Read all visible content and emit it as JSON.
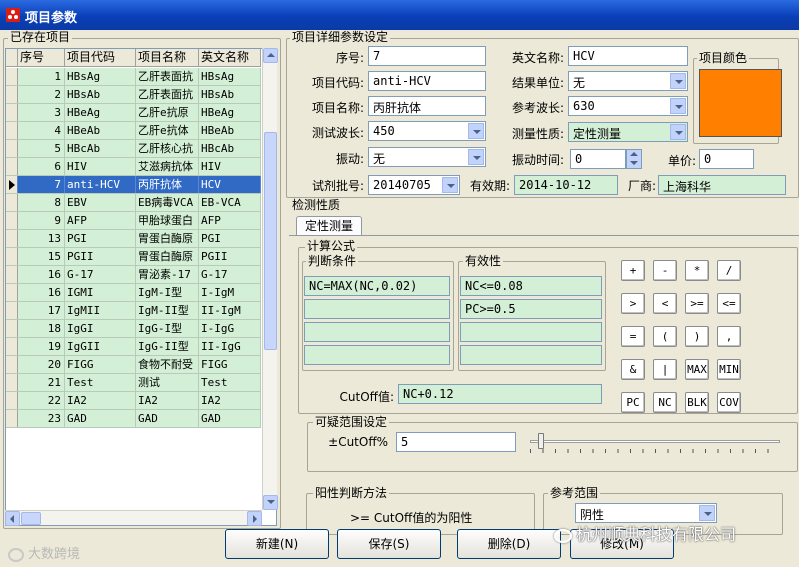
{
  "window": {
    "title": "项目参数"
  },
  "left": {
    "group_label": "已存在项目",
    "columns": [
      "序号",
      "项目代码",
      "项目名称",
      "英文名称"
    ],
    "rows": [
      [
        "1",
        "HBsAg",
        "乙肝表面抗",
        "HBsAg"
      ],
      [
        "2",
        "HBsAb",
        "乙肝表面抗",
        "HBsAb"
      ],
      [
        "3",
        "HBeAg",
        "乙肝e抗原",
        "HBeAg"
      ],
      [
        "4",
        "HBeAb",
        "乙肝e抗体",
        "HBeAb"
      ],
      [
        "5",
        "HBcAb",
        "乙肝核心抗",
        "HBcAb"
      ],
      [
        "6",
        "HIV",
        "艾滋病抗体",
        "HIV"
      ],
      [
        "7",
        "anti-HCV",
        "丙肝抗体",
        "HCV"
      ],
      [
        "8",
        "EBV",
        "EB病毒VCA",
        "EB-VCA"
      ],
      [
        "9",
        "AFP",
        "甲胎球蛋白",
        "AFP"
      ],
      [
        "13",
        "PGI",
        "胃蛋白酶原",
        "PGI"
      ],
      [
        "15",
        "PGII",
        "胃蛋白酶原",
        "PGII"
      ],
      [
        "16",
        "G-17",
        "胃泌素-17",
        "G-17"
      ],
      [
        "16",
        "IGMI",
        "IgM-I型",
        "I-IgM"
      ],
      [
        "17",
        "IgMII",
        "IgM-II型",
        "II-IgM"
      ],
      [
        "18",
        "IgGI",
        "IgG-I型",
        "I-IgG"
      ],
      [
        "19",
        "IgGII",
        "IgG-II型",
        "II-IgG"
      ],
      [
        "20",
        "FIGG",
        "食物不耐受",
        "FIGG"
      ],
      [
        "21",
        "Test",
        "测试",
        "Test"
      ],
      [
        "22",
        "IA2",
        "IA2",
        "IA2"
      ],
      [
        "23",
        "GAD",
        "GAD",
        "GAD"
      ]
    ],
    "selected_index": 6
  },
  "detail": {
    "group_label": "项目详细参数设定",
    "seq_label": "序号:",
    "seq": "7",
    "code_label": "项目代码:",
    "code": "anti-HCV",
    "name_label": "项目名称:",
    "name": "丙肝抗体",
    "wave_label": "测试波长:",
    "wave": "450",
    "shake_label": "振动:",
    "shake": "无",
    "batch_label": "试剂批号:",
    "batch": "20140705",
    "expiry_label": "有效期:",
    "expiry": "2014-10-12",
    "vendor_label": "厂商:",
    "vendor": "上海科华",
    "en_label": "英文名称:",
    "en": "HCV",
    "unit_label": "结果单位:",
    "unit": "无",
    "refwave_label": "参考波长:",
    "refwave": "630",
    "prop_label": "测量性质:",
    "prop": "定性测量",
    "shaketime_label": "振动时间:",
    "shaketime": "0",
    "price_label": "单价:",
    "price": "0",
    "color_label": "项目颜色",
    "color": "#ff7f00"
  },
  "nature": {
    "group_label": "检测性质",
    "tab": "定性测量",
    "formula_label": "计算公式",
    "cond_label": "判断条件",
    "valid_label": "有效性",
    "conditions": [
      "NC=MAX(NC,0.02)",
      "",
      "",
      ""
    ],
    "validity": [
      "NC<=0.08",
      "PC>=0.5",
      "",
      ""
    ],
    "cutoff_label": "CutOff值:",
    "cutoff": "NC+0.12",
    "calc_keys": [
      "+",
      "-",
      "*",
      "/",
      ">",
      "<",
      ">=",
      "<=",
      "=",
      "(",
      ")",
      ",",
      "&",
      "|",
      "MAX",
      "MIN",
      "PC",
      "NC",
      "BLK",
      "COV"
    ],
    "doubt_label": "可疑范围设定",
    "doubt_field_label": "±CutOff%",
    "doubt_value": "5",
    "pos_label": "阳性判断方法",
    "pos_text": ">= CutOff值的为阳性",
    "ref_label": "参考范围",
    "ref_value": "阴性"
  },
  "buttons": {
    "new": "新建(N)",
    "save": "保存(S)",
    "delete": "删除(D)",
    "modify": "修改(M)"
  },
  "watermarks": {
    "left": "大数跨境",
    "right": "杭州顺典科技有限公司"
  }
}
